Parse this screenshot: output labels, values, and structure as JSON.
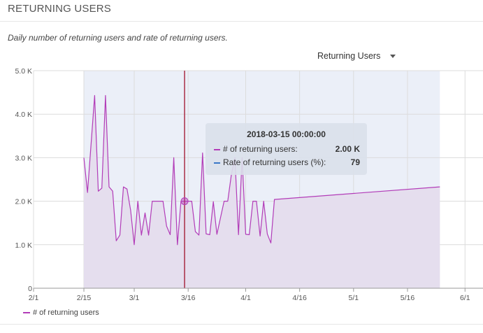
{
  "header": {
    "title": "RETURNING USERS"
  },
  "subtitle": "Daily number of returning users and rate of returning users.",
  "metric_selector": {
    "label": "Returning Users",
    "icon": "caret-down-icon"
  },
  "tooltip": {
    "title": "2018-03-15 00:00:00",
    "rows": [
      {
        "label": "# of returning users:",
        "value": "2.00 K",
        "color": "#b23cb8"
      },
      {
        "label": "Rate of returning users (%):",
        "value": "79",
        "color": "#3a78c8"
      }
    ]
  },
  "legend": {
    "label": "# of returning users",
    "color": "#b23cb8"
  },
  "colors": {
    "series": "#b23cb8",
    "area_fill": "#e5deee",
    "shaded_range": "#ebeff8",
    "cursor": "#a0102a",
    "grid": "#dcdcdc"
  },
  "chart_data": {
    "type": "area",
    "title": "",
    "xlabel": "",
    "ylabel": "",
    "x_range": [
      "2018-02-01",
      "2018-06-06"
    ],
    "ylim": [
      0,
      5000
    ],
    "grid": true,
    "legend_position": "bottom-left",
    "shaded_range": [
      "2018-02-15",
      "2018-05-25"
    ],
    "highlight": {
      "x": "2018-03-15",
      "y": 2000
    },
    "x_ticks": [
      {
        "date": "2018-02-01",
        "label": "2/1"
      },
      {
        "date": "2018-02-15",
        "label": "2/15"
      },
      {
        "date": "2018-03-01",
        "label": "3/1"
      },
      {
        "date": "2018-03-16",
        "label": "3/16"
      },
      {
        "date": "2018-04-01",
        "label": "4/1"
      },
      {
        "date": "2018-04-16",
        "label": "4/16"
      },
      {
        "date": "2018-05-01",
        "label": "5/1"
      },
      {
        "date": "2018-05-16",
        "label": "5/16"
      },
      {
        "date": "2018-06-01",
        "label": "6/1"
      }
    ],
    "y_ticks": [
      {
        "value": 0,
        "label": "0"
      },
      {
        "value": 1000,
        "label": "1.0 K"
      },
      {
        "value": 2000,
        "label": "2.0 K"
      },
      {
        "value": 3000,
        "label": "3.0 K"
      },
      {
        "value": 4000,
        "label": "4.0 K"
      },
      {
        "value": 5000,
        "label": "5.0 K"
      }
    ],
    "series": [
      {
        "name": "# of returning users",
        "points": [
          [
            "2018-02-15",
            3000
          ],
          [
            "2018-02-16",
            2200
          ],
          [
            "2018-02-18",
            4430
          ],
          [
            "2018-02-19",
            2230
          ],
          [
            "2018-02-20",
            2300
          ],
          [
            "2018-02-21",
            4430
          ],
          [
            "2018-02-22",
            2330
          ],
          [
            "2018-02-23",
            2230
          ],
          [
            "2018-02-24",
            1090
          ],
          [
            "2018-02-25",
            1220
          ],
          [
            "2018-02-26",
            2330
          ],
          [
            "2018-02-27",
            2280
          ],
          [
            "2018-02-28",
            1790
          ],
          [
            "2018-03-01",
            1000
          ],
          [
            "2018-03-02",
            2000
          ],
          [
            "2018-03-03",
            1220
          ],
          [
            "2018-03-04",
            1730
          ],
          [
            "2018-03-05",
            1220
          ],
          [
            "2018-03-06",
            2000
          ],
          [
            "2018-03-09",
            2000
          ],
          [
            "2018-03-10",
            1430
          ],
          [
            "2018-03-11",
            1230
          ],
          [
            "2018-03-12",
            3000
          ],
          [
            "2018-03-13",
            1000
          ],
          [
            "2018-03-14",
            2000
          ],
          [
            "2018-03-15",
            2000
          ],
          [
            "2018-03-16",
            2000
          ],
          [
            "2018-03-17",
            2000
          ],
          [
            "2018-03-18",
            1300
          ],
          [
            "2018-03-19",
            1220
          ],
          [
            "2018-03-20",
            3110
          ],
          [
            "2018-03-21",
            1250
          ],
          [
            "2018-03-22",
            1230
          ],
          [
            "2018-03-23",
            1990
          ],
          [
            "2018-03-24",
            1240
          ],
          [
            "2018-03-26",
            2000
          ],
          [
            "2018-03-27",
            2000
          ],
          [
            "2018-03-28",
            2600
          ],
          [
            "2018-03-29",
            3000
          ],
          [
            "2018-03-30",
            1230
          ],
          [
            "2018-03-31",
            3000
          ],
          [
            "2018-04-01",
            1240
          ],
          [
            "2018-04-02",
            1230
          ],
          [
            "2018-04-03",
            2000
          ],
          [
            "2018-04-04",
            2000
          ],
          [
            "2018-04-05",
            1200
          ],
          [
            "2018-04-06",
            2000
          ],
          [
            "2018-04-07",
            1250
          ],
          [
            "2018-04-08",
            1040
          ],
          [
            "2018-04-09",
            2040
          ],
          [
            "2018-05-25",
            2330
          ]
        ]
      }
    ]
  }
}
